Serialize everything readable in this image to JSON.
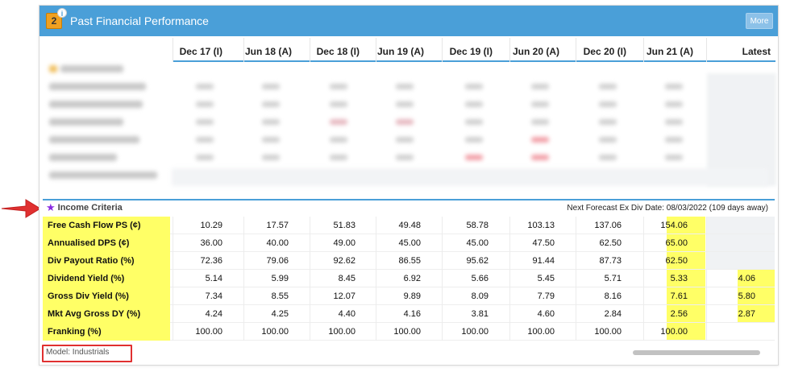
{
  "header": {
    "badge_number": "2",
    "info_icon": "i",
    "title": "Past Financial Performance",
    "more_label": "More"
  },
  "columns": [
    "Dec 17 (I)",
    "Jun 18 (A)",
    "Dec 18 (I)",
    "Jun 19 (A)",
    "Dec 19 (I)",
    "Jun 20 (A)",
    "Dec 20 (I)",
    "Jun 21 (A)",
    "Latest"
  ],
  "income": {
    "title": "Income Criteria",
    "next_div": "Next Forecast Ex Div Date: 08/03/2022 (109 days away)",
    "rows": [
      {
        "label": "Free Cash Flow PS (¢)",
        "values": [
          "10.29",
          "17.57",
          "51.83",
          "49.48",
          "58.78",
          "103.13",
          "137.06",
          "154.06",
          ""
        ]
      },
      {
        "label": "Annualised DPS (¢)",
        "values": [
          "36.00",
          "40.00",
          "49.00",
          "45.00",
          "45.00",
          "47.50",
          "62.50",
          "65.00",
          ""
        ]
      },
      {
        "label": "Div Payout Ratio (%)",
        "values": [
          "72.36",
          "79.06",
          "92.62",
          "86.55",
          "95.62",
          "91.44",
          "87.73",
          "62.50",
          ""
        ]
      },
      {
        "label": "Dividend Yield (%)",
        "values": [
          "5.14",
          "5.99",
          "8.45",
          "6.92",
          "5.66",
          "5.45",
          "5.71",
          "5.33",
          "4.06"
        ]
      },
      {
        "label": "Gross Div Yield (%)",
        "values": [
          "7.34",
          "8.55",
          "12.07",
          "9.89",
          "8.09",
          "7.79",
          "8.16",
          "7.61",
          "5.80"
        ]
      },
      {
        "label": "Mkt Avg Gross DY (%)",
        "values": [
          "4.24",
          "4.25",
          "4.40",
          "4.16",
          "3.81",
          "4.60",
          "2.84",
          "2.56",
          "2.87"
        ]
      },
      {
        "label": "Franking (%)",
        "values": [
          "100.00",
          "100.00",
          "100.00",
          "100.00",
          "100.00",
          "100.00",
          "100.00",
          "100.00",
          ""
        ]
      }
    ]
  },
  "footer": {
    "model": "Model: Industrials"
  },
  "colors": {
    "header_blue": "#4a9fd8",
    "highlight_yellow": "#ffff66",
    "annotation_red": "#e03030",
    "star_purple": "#8a2be2"
  }
}
